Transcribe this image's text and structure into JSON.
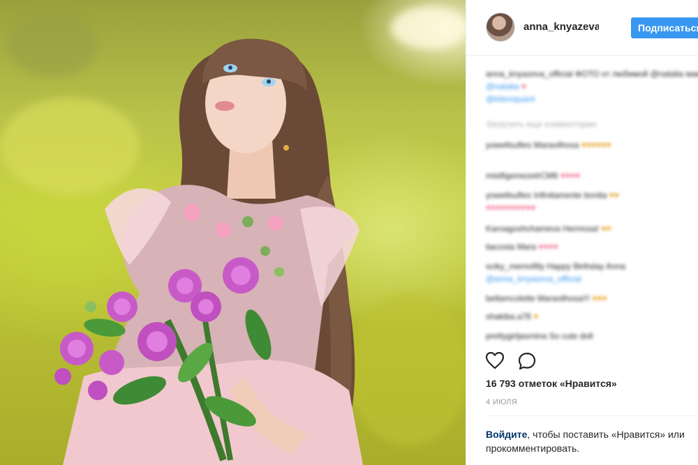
{
  "header": {
    "username": "anna_knyazeva_official",
    "follow_label": "Подписаться"
  },
  "caption": {
    "text": "anna_knyazeva_official ФОТО от любимой @natalia мама @",
    "link_text": "@kilemquant"
  },
  "comments": {
    "load_more_label": "Загрузить еще комментарии",
    "items": [
      {
        "text": "yowellsuftes Maravilhosa"
      },
      {
        "text": "mistfigemezetrCM6"
      },
      {
        "text": "yowellsuftes Infinitamente bonita"
      },
      {
        "text": "Karoagoshchameva Hermosa!"
      },
      {
        "text": "tiacosta Mara"
      },
      {
        "text": "sciky_memofilly Happy Birthday Anna"
      },
      {
        "text": "@anna_knyazeva_official"
      },
      {
        "text": "bellamcolette Maravilhosa!!!"
      },
      {
        "text": "shakiba.a78"
      },
      {
        "text": "prettygirljasmina So cute doll"
      }
    ]
  },
  "actions": {
    "like_icon": "heart-icon",
    "comment_icon": "comment-icon"
  },
  "likes_text": "16 793 отметок «Нравится»",
  "date_text": "4 ИЮЛЯ",
  "login": {
    "link": "Войдите",
    "rest": ", чтобы поставить «Нравится» или прокомментировать."
  },
  "colors": {
    "accent": "#3897f0",
    "text": "#262626",
    "muted": "#999999",
    "link": "#003569"
  }
}
